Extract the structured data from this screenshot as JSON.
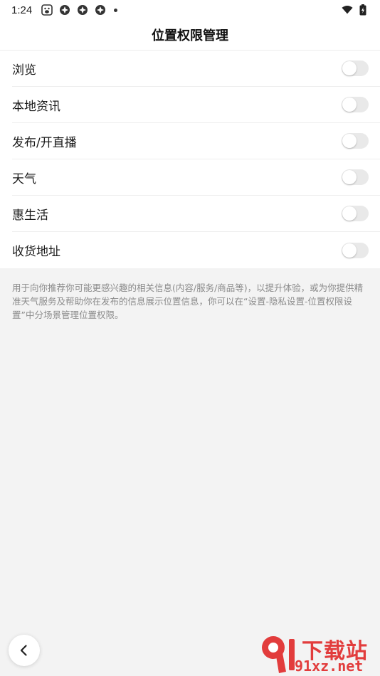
{
  "status_bar": {
    "time": "1:24",
    "icons": [
      "baidu-icon",
      "app-icon",
      "app-icon",
      "app-icon",
      "notification-dot"
    ],
    "right_icons": [
      "wifi-icon",
      "battery-charging-icon"
    ]
  },
  "header": {
    "title": "位置权限管理"
  },
  "settings": [
    {
      "label": "浏览",
      "enabled": false
    },
    {
      "label": "本地资讯",
      "enabled": false
    },
    {
      "label": "发布/开直播",
      "enabled": false
    },
    {
      "label": "天气",
      "enabled": false
    },
    {
      "label": "惠生活",
      "enabled": false
    },
    {
      "label": "收货地址",
      "enabled": false
    }
  ],
  "description": "用于向你推荐你可能更感兴趣的相关信息(内容/服务/商品等)，以提升体验，或为你提供精准天气服务及帮助你在发布的信息展示位置信息，你可以在“设置-隐私设置-位置权限设置”中分场景管理位置权限。",
  "watermark": {
    "title": "下载站",
    "url": "91xz.net"
  },
  "colors": {
    "toggle_off": "#e9e9e9",
    "watermark": "#e23c3c",
    "background": "#f3f3f3"
  }
}
